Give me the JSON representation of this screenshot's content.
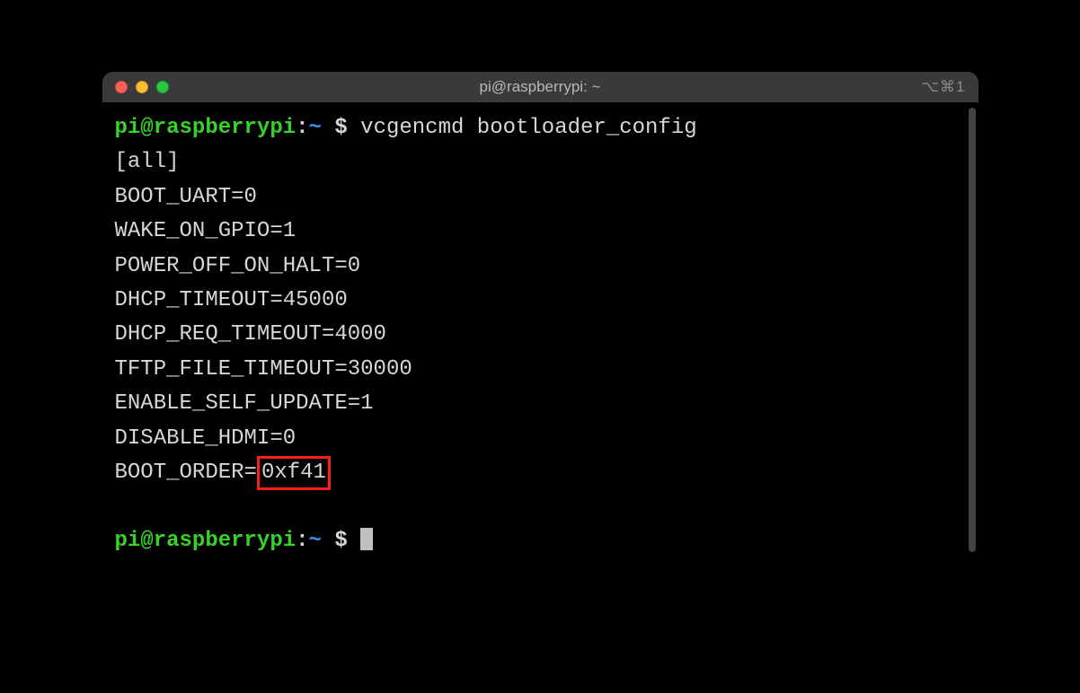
{
  "window": {
    "title": "pi@raspberrypi: ~",
    "right_indicator": "⌥⌘1"
  },
  "prompt": {
    "user_host": "pi@raspberrypi",
    "separator": ":",
    "path": "~",
    "symbol": " $ "
  },
  "command": "vcgencmd bootloader_config",
  "output_lines": [
    "[all]",
    "BOOT_UART=0",
    "WAKE_ON_GPIO=1",
    "POWER_OFF_ON_HALT=0",
    "DHCP_TIMEOUT=45000",
    "DHCP_REQ_TIMEOUT=4000",
    "TFTP_FILE_TIMEOUT=30000",
    "ENABLE_SELF_UPDATE=1",
    "DISABLE_HDMI=0"
  ],
  "highlighted_line": {
    "prefix": "BOOT_ORDER=",
    "highlighted": "0xf41"
  }
}
